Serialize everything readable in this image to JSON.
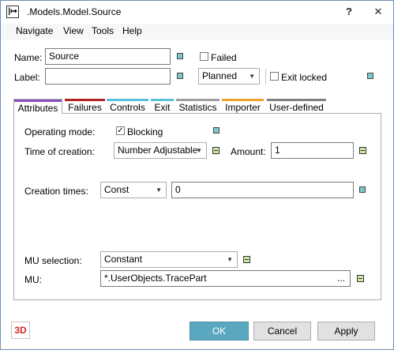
{
  "window": {
    "title": ".Models.Model.Source",
    "help_glyph": "?",
    "close_glyph": "✕",
    "app_glyph": "|↦"
  },
  "menu": {
    "items": [
      "Navigate",
      "View",
      "Tools",
      "Help"
    ]
  },
  "form": {
    "name_label": "Name:",
    "name_value": "Source",
    "failed_label": "Failed",
    "label_label": "Label:",
    "label_value": "",
    "state_value": "Planned",
    "exit_locked_label": "Exit locked"
  },
  "tabs": [
    {
      "label": "Attributes",
      "color": "#8a4fc7"
    },
    {
      "label": "Failures",
      "color": "#b22222"
    },
    {
      "label": "Controls",
      "color": "#5bc0de"
    },
    {
      "label": "Exit",
      "color": "#5bc0de"
    },
    {
      "label": "Statistics",
      "color": "#a0a0a0"
    },
    {
      "label": "Importer",
      "color": "#f0a030"
    },
    {
      "label": "User-defined",
      "color": "#808080"
    }
  ],
  "attributes": {
    "operating_mode_label": "Operating mode:",
    "blocking_label": "Blocking",
    "time_of_creation_label": "Time of creation:",
    "time_of_creation_value": "Number Adjustable",
    "amount_label": "Amount:",
    "amount_value": "1",
    "creation_times_label": "Creation times:",
    "creation_times_value": "Const",
    "creation_times_number": "0",
    "mu_selection_label": "MU selection:",
    "mu_selection_value": "Constant",
    "mu_label": "MU:",
    "mu_value": "*.UserObjects.TracePart",
    "mu_browse": "..."
  },
  "footer": {
    "badge": "3D",
    "ok": "OK",
    "cancel": "Cancel",
    "apply": "Apply"
  }
}
